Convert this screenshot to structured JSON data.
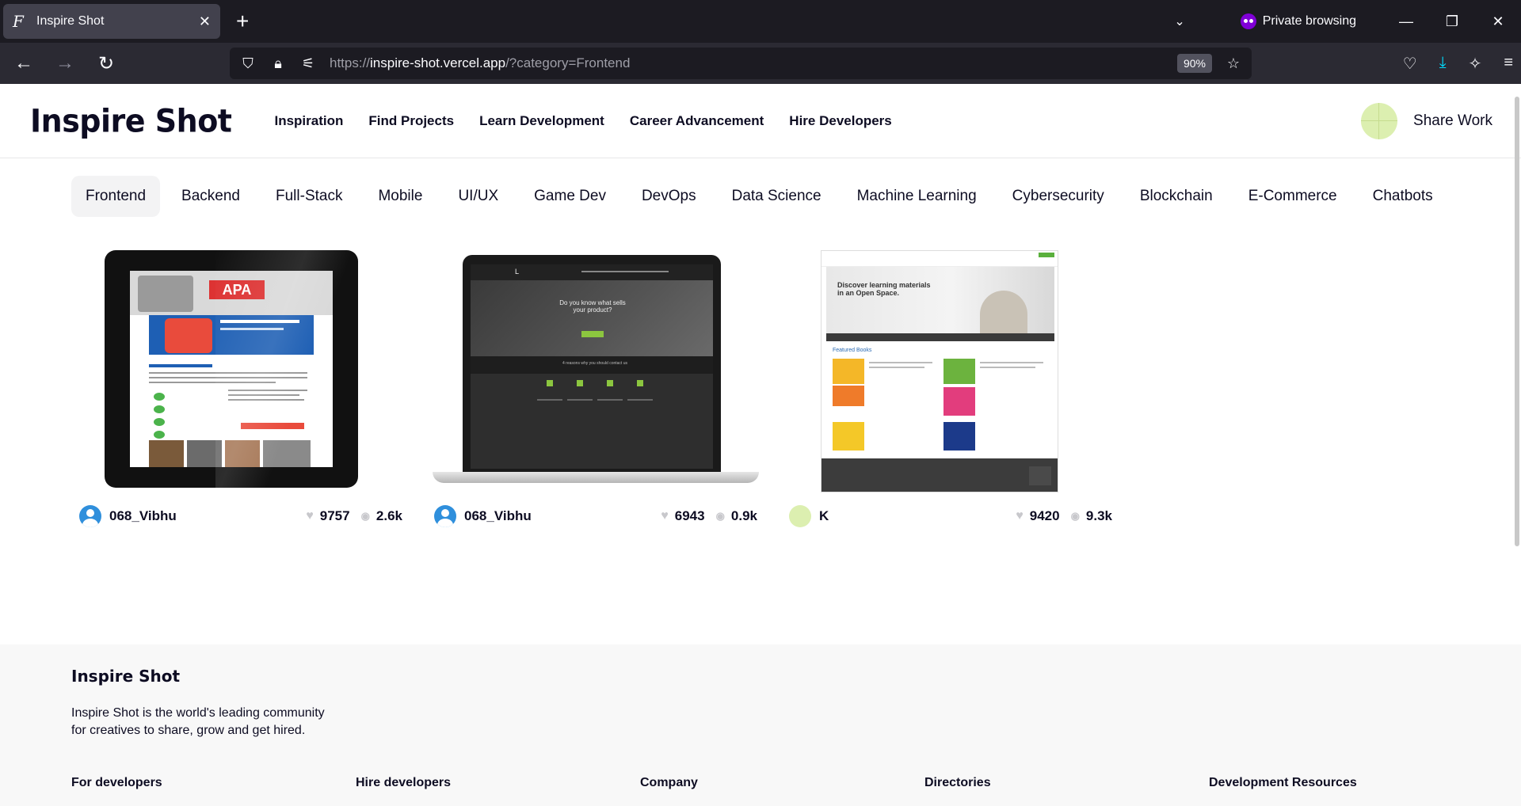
{
  "browser": {
    "tab_title": "Inspire Shot",
    "tab_favicon": "F",
    "private_label": "Private browsing",
    "url_prefix": "https://",
    "url_host": "inspire-shot.vercel.app",
    "url_path": "/?category=Frontend",
    "zoom": "90%"
  },
  "header": {
    "logo": "Inspire Shot",
    "nav": [
      "Inspiration",
      "Find Projects",
      "Learn Development",
      "Career Advancement",
      "Hire Developers"
    ],
    "share": "Share Work"
  },
  "categories": [
    "Frontend",
    "Backend",
    "Full-Stack",
    "Mobile",
    "UI/UX",
    "Game Dev",
    "DevOps",
    "Data Science",
    "Machine Learning",
    "Cybersecurity",
    "Blockchain",
    "E-Commerce",
    "Chatbots"
  ],
  "active_category": "Frontend",
  "cards": [
    {
      "user": "068_Vibhu",
      "likes": "9757",
      "views": "2.6k",
      "avatar": "blue"
    },
    {
      "user": "068_Vibhu",
      "likes": "6943",
      "views": "0.9k",
      "avatar": "blue"
    },
    {
      "user": "K",
      "likes": "9420",
      "views": "9.3k",
      "avatar": "green"
    }
  ],
  "thumb2": {
    "headline": "Do you know what sells your product?",
    "band": "4 reasons why you should contact us"
  },
  "thumb3": {
    "hero": "Discover learning materials in an Open Space.",
    "featured": "Featured Books"
  },
  "footer": {
    "logo": "Inspire Shot",
    "tagline_1": "Inspire Shot is the world's leading community",
    "tagline_2": "for creatives to share, grow and get hired.",
    "columns": [
      "For developers",
      "Hire developers",
      "Company",
      "Directories",
      "Development Resources"
    ]
  }
}
